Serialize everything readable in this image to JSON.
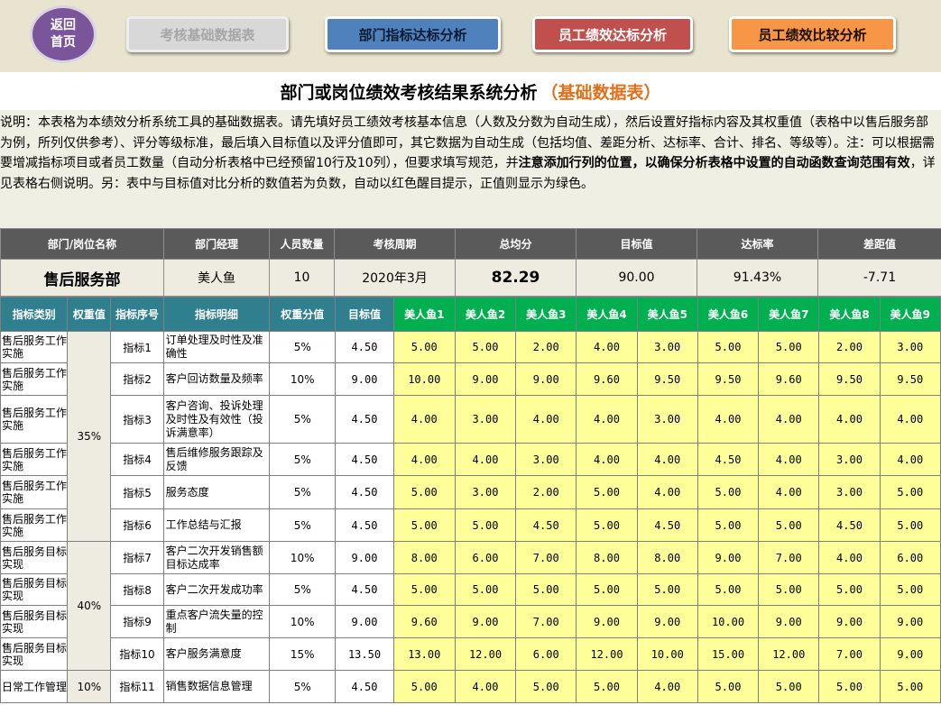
{
  "nav": {
    "home_label": "返回首页",
    "basic_data": "考核基础数据表",
    "dept_analysis": "部门指标达标分析",
    "emp_analysis": "员工绩效达标分析",
    "emp_compare": "员工绩效比较分析"
  },
  "title": {
    "main": "部门或岗位绩效考核结果系统分析",
    "sub": "（基础数据表）"
  },
  "description": {
    "part1": "说明：本表格为本绩效分析系统工具的基础数据表。请先填好员工绩效考核基本信息（人数及分数为自动生成），然后设置好指标内容及其权重值（表格中以售后服务部为例，所列仅供参考）、评分等级标准，最后填入目标值以及评分值即可，其它数据为自动生成（包括均值、差距分析、达标率、合计、排名、等级等）。注：可以根据需要增减指标项目或者员工数量（自动分析表格中已经预留10行及10列），但要求填写规范，并",
    "bold": "注意添加行列的位置，以确保分析表格中设置的自动函数查询范围有效",
    "part2": "，详见表格右侧说明。另：表中与目标值对比分析的数值若为负数，自动以红色醒目提示，正值则显示为绿色。"
  },
  "summary": {
    "headers": [
      "部门/岗位名称",
      "部门经理",
      "人员数量",
      "考核周期",
      "总均分",
      "目标值",
      "达标率",
      "差距值"
    ],
    "values": [
      "售后服务部",
      "美人鱼",
      "10",
      "2020年3月",
      "82.29",
      "90.00",
      "91.43%",
      "-7.71"
    ]
  },
  "grid": {
    "headers": [
      "指标类别",
      "权重值",
      "指标序号",
      "指标明细",
      "权重分值",
      "目标值"
    ],
    "employees": [
      "美人鱼1",
      "美人鱼2",
      "美人鱼3",
      "美人鱼4",
      "美人鱼5",
      "美人鱼6",
      "美人鱼7",
      "美人鱼8",
      "美人鱼9"
    ],
    "group_weights": [
      "35%",
      "40%",
      "10%"
    ],
    "rows": [
      {
        "cat": "售后服务工作实施",
        "idx": "指标1",
        "detail": "订单处理及时性及准确性",
        "pct": "5%",
        "target": "4.50",
        "scores": [
          "5.00",
          "5.00",
          "2.00",
          "4.00",
          "3.00",
          "5.00",
          "5.00",
          "2.00",
          "3.00"
        ]
      },
      {
        "cat": "售后服务工作实施",
        "idx": "指标2",
        "detail": "客户回访数量及频率",
        "pct": "10%",
        "target": "9.00",
        "scores": [
          "10.00",
          "9.00",
          "9.00",
          "9.60",
          "9.50",
          "9.50",
          "9.60",
          "9.50",
          "9.50"
        ]
      },
      {
        "cat": "售后服务工作实施",
        "idx": "指标3",
        "detail": "客户咨询、投诉处理及时性及有效性（投诉满意率）",
        "pct": "5%",
        "target": "4.50",
        "scores": [
          "4.00",
          "3.00",
          "4.00",
          "4.00",
          "3.00",
          "4.00",
          "4.00",
          "4.00",
          "4.00"
        ]
      },
      {
        "cat": "售后服务工作实施",
        "idx": "指标4",
        "detail": "售后维修服务跟踪及反馈",
        "pct": "5%",
        "target": "4.50",
        "scores": [
          "4.00",
          "4.00",
          "3.00",
          "4.00",
          "4.00",
          "4.50",
          "4.00",
          "3.00",
          "4.00"
        ]
      },
      {
        "cat": "售后服务工作实施",
        "idx": "指标5",
        "detail": "服务态度",
        "pct": "5%",
        "target": "4.50",
        "scores": [
          "5.00",
          "3.00",
          "2.00",
          "5.00",
          "4.00",
          "5.00",
          "4.00",
          "3.00",
          "5.00"
        ]
      },
      {
        "cat": "售后服务工作实施",
        "idx": "指标6",
        "detail": "工作总结与汇报",
        "pct": "5%",
        "target": "4.50",
        "scores": [
          "5.00",
          "5.00",
          "4.50",
          "5.00",
          "4.50",
          "5.00",
          "5.00",
          "4.50",
          "5.00"
        ]
      },
      {
        "cat": "售后服务目标实现",
        "idx": "指标7",
        "detail": "客户二次开发销售额目标达成率",
        "pct": "10%",
        "target": "9.00",
        "scores": [
          "8.00",
          "6.00",
          "7.00",
          "8.00",
          "8.00",
          "9.00",
          "7.00",
          "4.00",
          "6.00"
        ]
      },
      {
        "cat": "售后服务目标实现",
        "idx": "指标8",
        "detail": "客户二次开发成功率",
        "pct": "5%",
        "target": "4.50",
        "scores": [
          "5.00",
          "5.00",
          "5.00",
          "5.00",
          "5.00",
          "5.00",
          "5.00",
          "5.00",
          "5.00"
        ]
      },
      {
        "cat": "售后服务目标实现",
        "idx": "指标9",
        "detail": "重点客户流失量的控制",
        "pct": "10%",
        "target": "9.00",
        "scores": [
          "9.60",
          "9.00",
          "7.00",
          "9.00",
          "9.00",
          "10.00",
          "9.00",
          "9.00",
          "9.00"
        ]
      },
      {
        "cat": "售后服务目标实现",
        "idx": "指标10",
        "detail": "客户服务满意度",
        "pct": "15%",
        "target": "13.50",
        "scores": [
          "13.00",
          "12.00",
          "6.00",
          "12.00",
          "10.00",
          "15.00",
          "12.00",
          "7.00",
          "9.00"
        ]
      },
      {
        "cat": "日常工作管理",
        "idx": "指标11",
        "detail": "销售数据信息管理",
        "pct": "5%",
        "target": "4.50",
        "scores": [
          "5.00",
          "4.00",
          "5.00",
          "5.00",
          "4.00",
          "5.00",
          "5.00",
          "5.00",
          "5.00"
        ]
      }
    ]
  }
}
